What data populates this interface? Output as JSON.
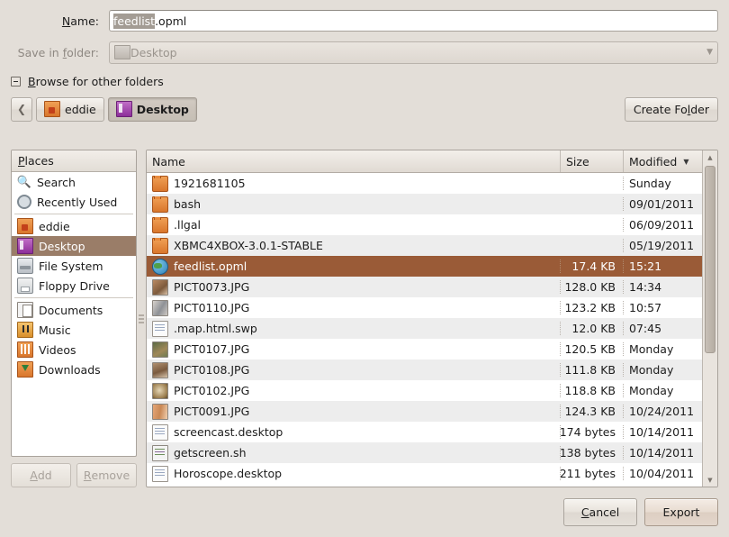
{
  "form": {
    "name_label": "Name:",
    "name_label_accel": "N",
    "name_value_selected": "feedlist",
    "name_value_rest": ".opml",
    "folder_label": "Save in folder:",
    "folder_label_accel": "f",
    "folder_value": "Desktop",
    "folder_icon": "folder-icon",
    "folder_chevron": "chevron-down-icon"
  },
  "expander": {
    "label_accel": "B",
    "label_rest": "rowse for other folders",
    "state_glyph": "minus-icon"
  },
  "pathbar": {
    "back_glyph": "chevron-left-icon",
    "crumbs": [
      {
        "label": "eddie",
        "icon": "home-folder-icon",
        "active": false
      },
      {
        "label": "Desktop",
        "icon": "desktop-folder-icon",
        "active": true
      }
    ],
    "create_folder_accel_pre": "Create Fo",
    "create_folder_accel": "l",
    "create_folder_accel_post": "der"
  },
  "places": {
    "header_accel": "P",
    "header_rest": "laces",
    "items": [
      {
        "label": "Search",
        "icon": "search-icon",
        "selected": false
      },
      {
        "label": "Recently Used",
        "icon": "clock-icon",
        "selected": false
      },
      {
        "sep": true
      },
      {
        "label": "eddie",
        "icon": "home-folder-icon",
        "selected": false
      },
      {
        "label": "Desktop",
        "icon": "desktop-folder-icon",
        "selected": true
      },
      {
        "label": "File System",
        "icon": "harddisk-icon",
        "selected": false
      },
      {
        "label": "Floppy Drive",
        "icon": "floppy-icon",
        "selected": false
      },
      {
        "sep": true
      },
      {
        "label": "Documents",
        "icon": "documents-folder-icon",
        "selected": false
      },
      {
        "label": "Music",
        "icon": "music-folder-icon",
        "selected": false
      },
      {
        "label": "Videos",
        "icon": "videos-folder-icon",
        "selected": false
      },
      {
        "label": "Downloads",
        "icon": "downloads-folder-icon",
        "selected": false
      }
    ],
    "add_accel": "A",
    "add_rest": "dd",
    "remove_accel": "R",
    "remove_rest": "emove"
  },
  "filelist": {
    "columns": {
      "name": "Name",
      "size": "Size",
      "modified": "Modified",
      "sort_glyph": "chevron-down-icon"
    },
    "rows": [
      {
        "name": "1921681105",
        "size": "",
        "modified": "Sunday",
        "icon": "folder-icon",
        "selected": false
      },
      {
        "name": "bash",
        "size": "",
        "modified": "09/01/2011",
        "icon": "folder-icon",
        "selected": false
      },
      {
        "name": ".llgal",
        "size": "",
        "modified": "06/09/2011",
        "icon": "folder-icon",
        "selected": false
      },
      {
        "name": "XBMC4XBOX-3.0.1-STABLE",
        "size": "",
        "modified": "05/19/2011",
        "icon": "folder-icon",
        "selected": false
      },
      {
        "name": "feedlist.opml",
        "size": "17.4 KB",
        "modified": "15:21",
        "icon": "globe-icon",
        "selected": true
      },
      {
        "name": "PICT0073.JPG",
        "size": "128.0 KB",
        "modified": "14:34",
        "icon": "image-thumbnail-icon",
        "thumb": 1,
        "selected": false
      },
      {
        "name": "PICT0110.JPG",
        "size": "123.2 KB",
        "modified": "10:57",
        "icon": "image-thumbnail-icon",
        "thumb": 2,
        "selected": false
      },
      {
        "name": ".map.html.swp",
        "size": "12.0 KB",
        "modified": "07:45",
        "icon": "document-icon",
        "selected": false
      },
      {
        "name": "PICT0107.JPG",
        "size": "120.5 KB",
        "modified": "Monday",
        "icon": "image-thumbnail-icon",
        "thumb": 3,
        "selected": false
      },
      {
        "name": "PICT0108.JPG",
        "size": "111.8 KB",
        "modified": "Monday",
        "icon": "image-thumbnail-icon",
        "thumb": 4,
        "selected": false
      },
      {
        "name": "PICT0102.JPG",
        "size": "118.8 KB",
        "modified": "Monday",
        "icon": "image-thumbnail-icon",
        "thumb": 5,
        "selected": false
      },
      {
        "name": "PICT0091.JPG",
        "size": "124.3 KB",
        "modified": "10/24/2011",
        "icon": "image-thumbnail-icon",
        "thumb": 6,
        "selected": false
      },
      {
        "name": "screencast.desktop",
        "size": "174 bytes",
        "modified": "10/14/2011",
        "icon": "document-icon",
        "selected": false
      },
      {
        "name": "getscreen.sh",
        "size": "138 bytes",
        "modified": "10/14/2011",
        "icon": "script-icon",
        "selected": false
      },
      {
        "name": "Horoscope.desktop",
        "size": "211 bytes",
        "modified": "10/04/2011",
        "icon": "document-icon",
        "selected": false
      }
    ],
    "scrollbar": {
      "up_glyph": "triangle-up-icon",
      "down_glyph": "triangle-down-icon",
      "thumb_percent": 60
    }
  },
  "actions": {
    "cancel_accel": "C",
    "cancel_rest": "ancel",
    "export_label": "Export"
  },
  "colors": {
    "window_bg": "#e3ded8",
    "row_selected": "#9a5b37",
    "place_selected": "#9a7d68",
    "text_selection": "#a39c94",
    "row_alt": "#ededed"
  }
}
